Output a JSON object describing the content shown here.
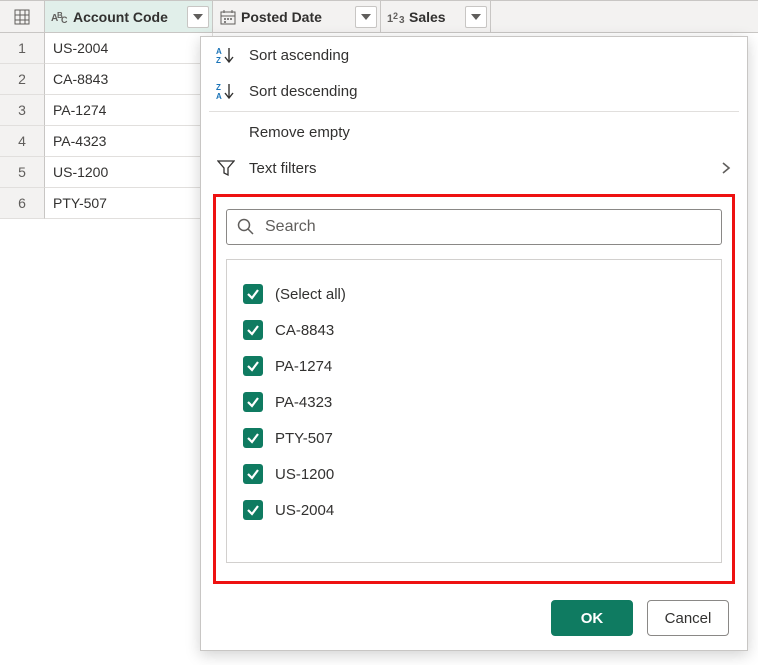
{
  "columns": {
    "account_code": "Account Code",
    "posted_date": "Posted Date",
    "sales": "Sales"
  },
  "rows": {
    "row_numbers": [
      "1",
      "2",
      "3",
      "4",
      "5",
      "6"
    ],
    "account_code": [
      "US-2004",
      "CA-8843",
      "PA-1274",
      "PA-4323",
      "US-1200",
      "PTY-507"
    ]
  },
  "menu": {
    "sort_asc": "Sort ascending",
    "sort_desc": "Sort descending",
    "remove_empty": "Remove empty",
    "text_filters": "Text filters",
    "search_placeholder": "Search",
    "select_all": "(Select all)",
    "options": [
      "CA-8843",
      "PA-1274",
      "PA-4323",
      "PTY-507",
      "US-1200",
      "US-2004"
    ],
    "ok": "OK",
    "cancel": "Cancel"
  }
}
